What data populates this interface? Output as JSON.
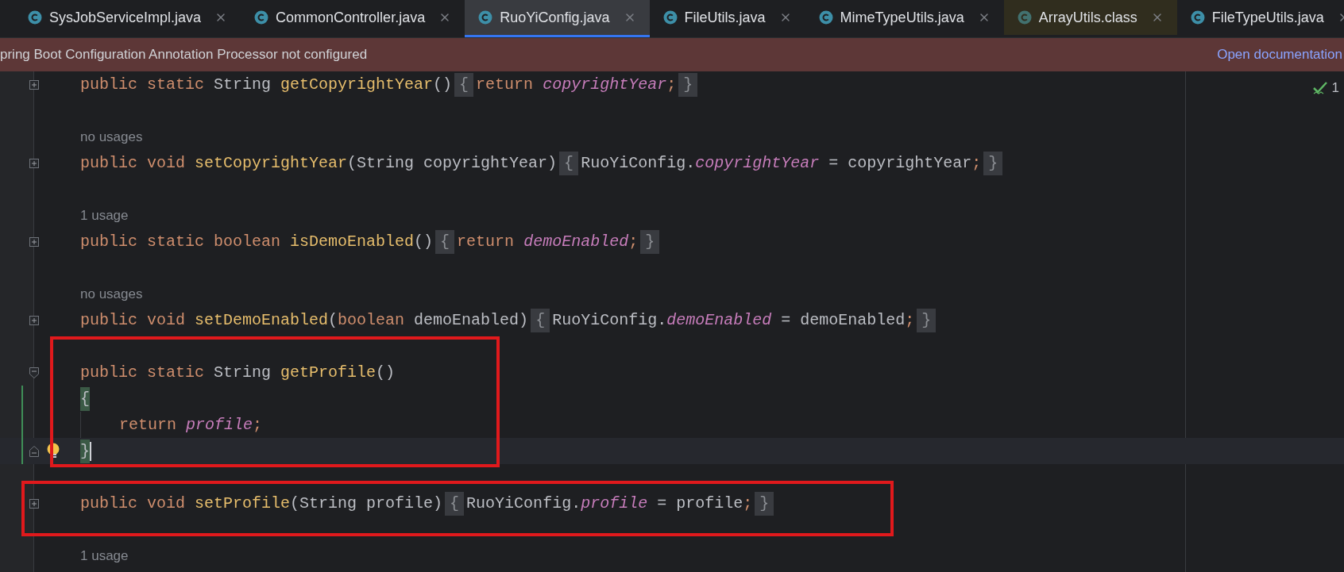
{
  "tabs": [
    {
      "label": "SysJobServiceImpl.java",
      "selected": false,
      "library": false
    },
    {
      "label": "CommonController.java",
      "selected": false,
      "library": false
    },
    {
      "label": "RuoYiConfig.java",
      "selected": true,
      "library": false
    },
    {
      "label": "FileUtils.java",
      "selected": false,
      "library": false
    },
    {
      "label": "MimeTypeUtils.java",
      "selected": false,
      "library": false
    },
    {
      "label": "ArrayUtils.class",
      "selected": false,
      "library": true
    },
    {
      "label": "FileTypeUtils.java",
      "selected": false,
      "library": false
    }
  ],
  "banner": {
    "message": "pring Boot Configuration Annotation Processor not configured",
    "link": "Open documentation"
  },
  "inspections": {
    "count": "1"
  },
  "blocks": [
    {
      "annotated": false,
      "lines": [
        {
          "kind": "code",
          "fold": {
            "kind": "collapsed"
          },
          "tokens": [
            {
              "t": "public ",
              "kind": "keyword"
            },
            {
              "t": "static ",
              "kind": "keyword"
            },
            {
              "t": "String ",
              "kind": "plain"
            },
            {
              "t": "getCopyrightYear",
              "kind": "method"
            },
            {
              "t": "()",
              "kind": "plain"
            },
            {
              "t": "{",
              "kind": "folded"
            },
            {
              "t": "return ",
              "kind": "keyword"
            },
            {
              "t": "copyrightYear",
              "kind": "field"
            },
            {
              "t": ";",
              "kind": "semicolon"
            },
            {
              "t": "}",
              "kind": "folded"
            }
          ]
        },
        {
          "kind": "blank"
        },
        {
          "kind": "hint",
          "text": "no usages"
        },
        {
          "kind": "code",
          "fold": {
            "kind": "collapsed"
          },
          "tokens": [
            {
              "t": "public ",
              "kind": "keyword"
            },
            {
              "t": "void ",
              "kind": "keyword"
            },
            {
              "t": "setCopyrightYear",
              "kind": "method"
            },
            {
              "t": "(String copyrightYear)",
              "kind": "plain"
            },
            {
              "t": "{",
              "kind": "folded"
            },
            {
              "t": "RuoYiConfig.",
              "kind": "plain"
            },
            {
              "t": "copyrightYear",
              "kind": "field"
            },
            {
              "t": " = copyrightYear",
              "kind": "plain"
            },
            {
              "t": ";",
              "kind": "semicolon"
            },
            {
              "t": "}",
              "kind": "folded"
            }
          ]
        },
        {
          "kind": "blank"
        },
        {
          "kind": "hint",
          "text": "1 usage"
        },
        {
          "kind": "code",
          "fold": {
            "kind": "collapsed"
          },
          "tokens": [
            {
              "t": "public ",
              "kind": "keyword"
            },
            {
              "t": "static ",
              "kind": "keyword"
            },
            {
              "t": "boolean ",
              "kind": "keyword"
            },
            {
              "t": "isDemoEnabled",
              "kind": "method"
            },
            {
              "t": "()",
              "kind": "plain"
            },
            {
              "t": "{",
              "kind": "folded"
            },
            {
              "t": "return ",
              "kind": "keyword"
            },
            {
              "t": "demoEnabled",
              "kind": "field"
            },
            {
              "t": ";",
              "kind": "semicolon"
            },
            {
              "t": "}",
              "kind": "folded"
            }
          ]
        },
        {
          "kind": "blank"
        },
        {
          "kind": "hint",
          "text": "no usages"
        },
        {
          "kind": "code",
          "fold": {
            "kind": "collapsed"
          },
          "tokens": [
            {
              "t": "public ",
              "kind": "keyword"
            },
            {
              "t": "void ",
              "kind": "keyword"
            },
            {
              "t": "setDemoEnabled",
              "kind": "method"
            },
            {
              "t": "(",
              "kind": "plain"
            },
            {
              "t": "boolean ",
              "kind": "keyword"
            },
            {
              "t": "demoEnabled)",
              "kind": "plain"
            },
            {
              "t": "{",
              "kind": "folded"
            },
            {
              "t": "RuoYiConfig.",
              "kind": "plain"
            },
            {
              "t": "demoEnabled",
              "kind": "field"
            },
            {
              "t": " = demoEnabled",
              "kind": "plain"
            },
            {
              "t": ";",
              "kind": "semicolon"
            },
            {
              "t": "}",
              "kind": "folded"
            }
          ]
        }
      ]
    },
    {
      "annotated": true,
      "lines": [
        {
          "kind": "blank"
        },
        {
          "kind": "code",
          "fold": {
            "kind": "start"
          },
          "tokens": [
            {
              "t": "public ",
              "kind": "keyword"
            },
            {
              "t": "static ",
              "kind": "keyword"
            },
            {
              "t": "String ",
              "kind": "plain"
            },
            {
              "t": "getProfile",
              "kind": "method"
            },
            {
              "t": "()",
              "kind": "plain"
            }
          ]
        },
        {
          "kind": "code",
          "changed": true,
          "tokens": [
            {
              "t": "{",
              "kind": "matched"
            }
          ]
        },
        {
          "kind": "code",
          "changed": true,
          "indented": true,
          "tokens": [
            {
              "t": "return ",
              "kind": "keyword"
            },
            {
              "t": "profile",
              "kind": "field"
            },
            {
              "t": ";",
              "kind": "semicolon"
            }
          ]
        },
        {
          "kind": "code",
          "changed": true,
          "fold": {
            "kind": "end"
          },
          "current": true,
          "bulb": true,
          "tokens": [
            {
              "t": "}",
              "kind": "matched"
            }
          ]
        }
      ]
    },
    {
      "annotated": false,
      "lines": [
        {
          "kind": "blank"
        }
      ]
    },
    {
      "annotated": true,
      "lines": [
        {
          "kind": "code",
          "fold": {
            "kind": "collapsed"
          },
          "tokens": [
            {
              "t": "public ",
              "kind": "keyword"
            },
            {
              "t": "void ",
              "kind": "keyword"
            },
            {
              "t": "setProfile",
              "kind": "method"
            },
            {
              "t": "(String profile)",
              "kind": "plain"
            },
            {
              "t": "{",
              "kind": "folded"
            },
            {
              "t": "RuoYiConfig.",
              "kind": "plain"
            },
            {
              "t": "profile",
              "kind": "field"
            },
            {
              "t": " = profile",
              "kind": "plain"
            },
            {
              "t": ";",
              "kind": "semicolon"
            },
            {
              "t": "}",
              "kind": "folded"
            }
          ]
        }
      ]
    },
    {
      "annotated": false,
      "lines": [
        {
          "kind": "blank"
        },
        {
          "kind": "hint",
          "text": "1 usage"
        }
      ]
    }
  ]
}
